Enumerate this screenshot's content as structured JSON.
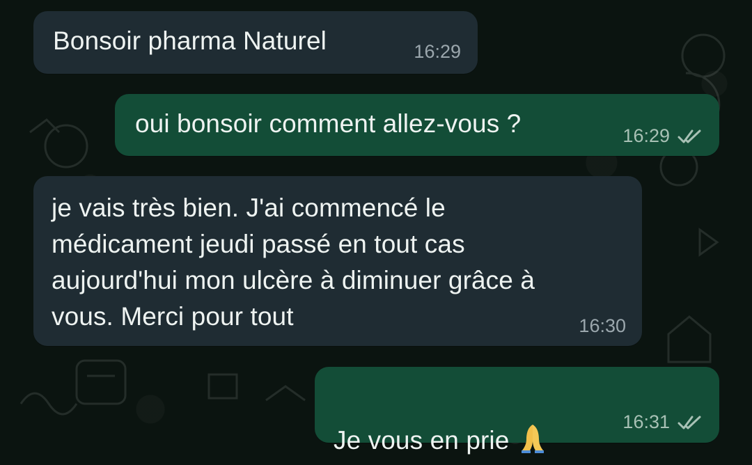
{
  "messages": [
    {
      "id": "m1",
      "direction": "incoming",
      "text": "Bonsoir pharma Naturel",
      "time": "16:29"
    },
    {
      "id": "m2",
      "direction": "outgoing",
      "text": "oui bonsoir comment allez-vous ?",
      "time": "16:29",
      "status": "read"
    },
    {
      "id": "m3",
      "direction": "incoming",
      "text": "je vais très bien. J'ai commencé le\nmédicament jeudi passé en tout cas\naujourd'hui mon ulcère à diminuer grâce à\nvous. Merci pour tout",
      "time": "16:30"
    },
    {
      "id": "m4",
      "direction": "outgoing",
      "text": "Je vous en prie",
      "emoji": "🙏",
      "time": "16:31",
      "status": "read"
    }
  ],
  "colors": {
    "background": "#0b1410",
    "incoming_bubble": "#1f2c33",
    "outgoing_bubble": "#134d37",
    "timestamp": "#9ba7ad",
    "read_ticks": "#a8c1b5"
  },
  "icons": {
    "read_status": "double-check-icon",
    "emoji": "folded-hands-emoji"
  }
}
